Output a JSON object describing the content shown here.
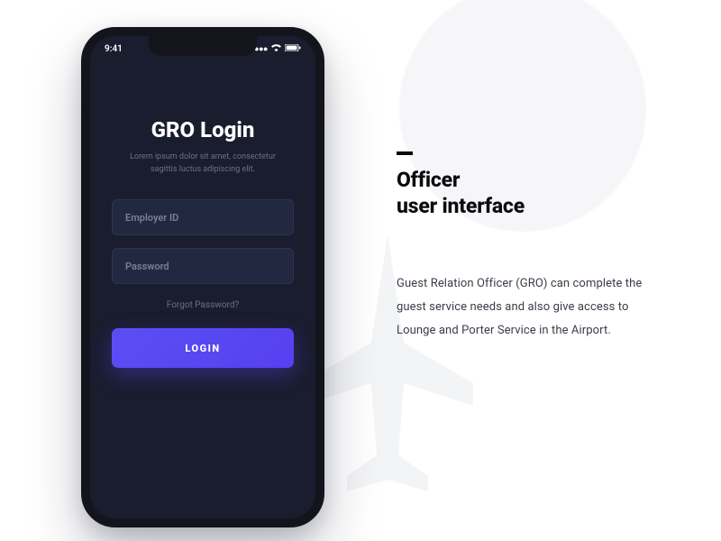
{
  "statusbar": {
    "time": "9:41",
    "signal": "▮▮▮▮",
    "wifi": "◉",
    "battery": "▬"
  },
  "login": {
    "title": "GRO Login",
    "subtitle": "Lorem ipsum dolor sit amet, consectetur sagittis luctus adipiscing elit.",
    "employer_placeholder": "Employer ID",
    "password_placeholder": "Password",
    "forgot": "Forgot Password?",
    "button": "LOGIN"
  },
  "copy": {
    "headline_line1": "Officer",
    "headline_line2": "user interface",
    "body": "Guest Relation Officer (GRO) can complete the guest service needs and also give access to Lounge and Porter Service in the Airport."
  }
}
